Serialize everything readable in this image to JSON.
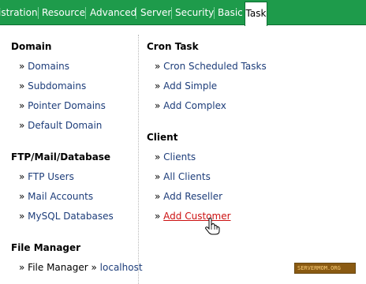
{
  "tabs": {
    "items": [
      "istration",
      "Resource",
      "Advanced",
      "Server",
      "Security",
      "Basic"
    ],
    "active": "Task"
  },
  "left": {
    "domain": {
      "heading": "Domain",
      "links": [
        "Domains",
        "Subdomains",
        "Pointer Domains",
        "Default Domain"
      ]
    },
    "ftp": {
      "heading": "FTP/Mail/Database",
      "links": [
        "FTP Users",
        "Mail Accounts",
        "MySQL Databases"
      ]
    },
    "filemanager": {
      "heading": "File Manager",
      "link": "File Manager",
      "sub": "localhost"
    }
  },
  "right": {
    "cron": {
      "heading": "Cron Task",
      "links": [
        "Cron Scheduled Tasks",
        "Add Simple",
        "Add Complex"
      ]
    },
    "client": {
      "heading": "Client",
      "links": [
        "Clients",
        "All Clients",
        "Add Reseller",
        "Add Customer"
      ]
    }
  },
  "bullet": "»",
  "watermark": "SERVERMOM.ORG",
  "colors": {
    "tabbar": "#1e9b4b",
    "link": "#1d3d7a",
    "hover_link": "#cc1010"
  },
  "icons": [
    "hand-cursor-icon"
  ]
}
